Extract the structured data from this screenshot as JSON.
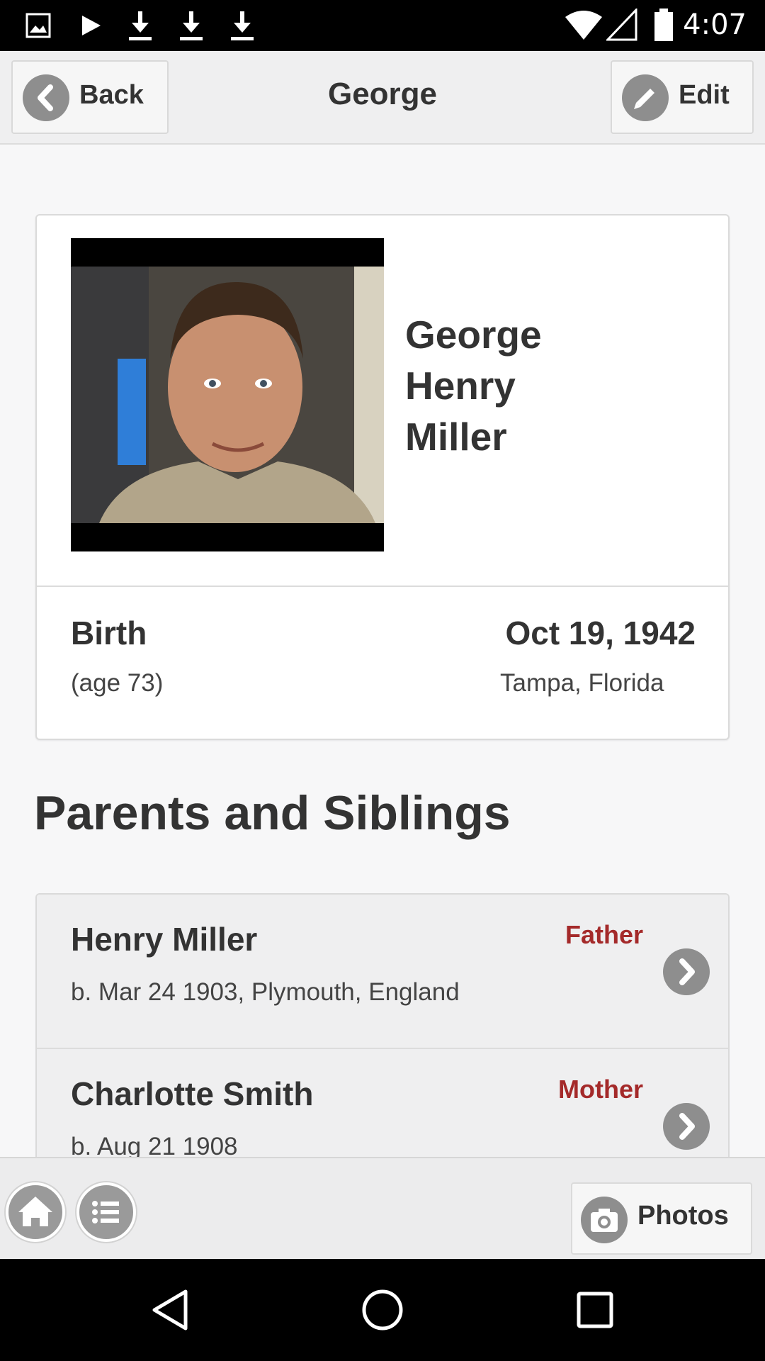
{
  "status_bar": {
    "time": "4:07",
    "left_icons": [
      "image-icon",
      "play-icon",
      "download-icon",
      "download-icon",
      "download-icon"
    ],
    "right_icons": [
      "wifi-icon",
      "signal-icon",
      "battery-icon"
    ]
  },
  "header": {
    "back_label": "Back",
    "title": "George",
    "edit_label": "Edit"
  },
  "profile": {
    "name_lines": [
      "George",
      "Henry",
      "Miller"
    ],
    "birth_label": "Birth",
    "age": "(age 73)",
    "birth_date": "Oct 19, 1942",
    "birth_place": "Tampa, Florida"
  },
  "section_title": "Parents and Siblings",
  "relatives": [
    {
      "name": "Henry Miller",
      "detail": "b. Mar 24 1903, Plymouth, England",
      "role": "Father"
    },
    {
      "name": "Charlotte Smith",
      "detail": "b. Aug 21 1908",
      "role": "Mother"
    }
  ],
  "toolbar": {
    "photos_label": "Photos"
  },
  "colors": {
    "role": "#a42a2a",
    "icon_circle": "#8e8e8e",
    "header_bg": "#efeff0"
  }
}
